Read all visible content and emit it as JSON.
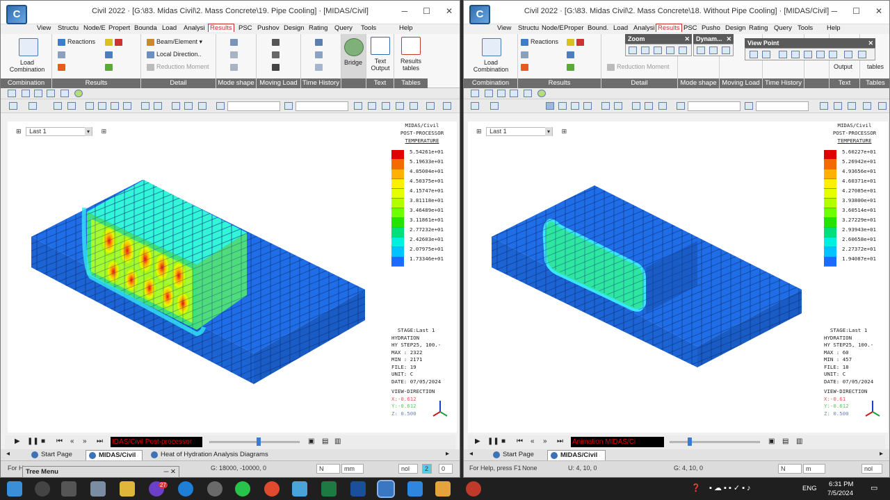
{
  "left": {
    "title": "Civil 2022 · [G:\\83. Midas Civil\\2. Mass Concrete\\19. Pipe Cooling] · [MIDAS/Civil]",
    "menu": [
      "View",
      "Structu",
      "Node/E",
      "Propert",
      "Bounda",
      "Load",
      "Analysi",
      "Results",
      "PSC",
      "Pushov",
      "Design",
      "Rating",
      "Query",
      "Tools",
      "Help"
    ],
    "ribbon": {
      "load_combination": "Load Combination",
      "reactions": "Reactions",
      "beam_element": "Beam/Element",
      "local_direction": "Local Direction..",
      "reduction_moment": "Reduction Moment",
      "bridge": "Bridge",
      "text_output": "Text Output",
      "results_tables": "Results tables",
      "groups": [
        "Combination",
        "Results",
        "Detail",
        "Mode shape",
        "Moving Load",
        "Time History",
        "",
        "Text",
        "Tables"
      ]
    },
    "stage": "Last 1",
    "legend": {
      "head": [
        "MIDAS/Civil",
        "POST-PROCESSOR",
        "TEMPERATURE"
      ],
      "values": [
        "5.54261e+01",
        "5.19633e+01",
        "4.85004e+01",
        "4.50375e+01",
        "4.15747e+01",
        "3.81118e+01",
        "3.46489e+01",
        "3.11861e+01",
        "2.77232e+01",
        "2.42603e+01",
        "2.07975e+01",
        "1.73346e+01"
      ],
      "colors": [
        "#e10000",
        "#f36b00",
        "#ffb000",
        "#fff000",
        "#e3ff00",
        "#b2ff00",
        "#6eff00",
        "#22e400",
        "#00e07a",
        "#00f0e0",
        "#00c4ff",
        "#1a6bff"
      ],
      "info": [
        "STAGE:Last 1",
        "HYDRATION",
        "HY STEP25, 100.-",
        "MAX : 2322",
        "MIN : 2171",
        "FILE: 19",
        "UNIT: C",
        "DATE: 07/05/2024"
      ],
      "view_dir": [
        "VIEW-DIRECTION",
        "X:-0.612",
        "Y:-0.612",
        "Z: 0.500"
      ]
    },
    "anim_label": "IDAS/Civil Post-processor",
    "tabs": [
      "Start Page",
      "MIDAS/Civil",
      "Heat of Hydration Analysis Diagrams"
    ],
    "status": {
      "help": "For H",
      "coords": "G: 18000, -10000, 0",
      "unit1": "N",
      "unit2": "mm",
      "nol": "nol",
      "num": "2",
      "zero": "0"
    },
    "tree_menu": "Tree Menu"
  },
  "right": {
    "title": "Civil 2022 · [G:\\83. Midas Civil\\2. Mass Concrete\\18. Without Pipe Cooling] · [MIDAS/Civil]",
    "menu": [
      "View",
      "Structu",
      "Node/E",
      "Proper",
      "Bound.",
      "Load",
      "Analysi",
      "Results",
      "PSC",
      "Pusho",
      "Design",
      "Rating",
      "Query",
      "Tools",
      "Help"
    ],
    "ribbon": {
      "load_combination": "Load Combination",
      "reactions": "Reactions",
      "reduction_moment": "Reduction Moment",
      "text_output": "Output",
      "results_tables": "tables",
      "groups": [
        "Combination",
        "Results",
        "Detail",
        "Mode shape",
        "Moving Load",
        "Time History",
        "Text",
        "Tables"
      ]
    },
    "panels": {
      "zoom": "Zoom",
      "dynamic": "Dynam...",
      "viewpoint": "View Point"
    },
    "stage": "Last 1",
    "legend": {
      "head": [
        "MIDAS/Civil",
        "POST-PROCESSOR",
        "TEMPERATURE"
      ],
      "values": [
        "5.60227e+01",
        "5.26942e+01",
        "4.93656e+01",
        "4.60371e+01",
        "4.27085e+01",
        "3.93800e+01",
        "3.60514e+01",
        "3.27229e+01",
        "2.93943e+01",
        "2.60658e+01",
        "2.27372e+01",
        "1.94087e+01"
      ],
      "colors": [
        "#e10000",
        "#f36b00",
        "#ffb000",
        "#fff000",
        "#e3ff00",
        "#b2ff00",
        "#6eff00",
        "#22e400",
        "#00e07a",
        "#00f0e0",
        "#00c4ff",
        "#1a6bff"
      ],
      "info": [
        "STAGE:Last 1",
        "HYDRATION",
        "HY STEP25, 100.-",
        "MAX : 60",
        "MIN : 457",
        "FILE: 18",
        "UNIT: C",
        "DATE: 07/05/2024"
      ],
      "view_dir": [
        "VIEW-DIRECTION",
        "X:-0.61",
        "Y:-0.612",
        "Z: 0.500"
      ]
    },
    "anim_label": "Animation     MIDAS/Ci",
    "tabs": [
      "Start Page",
      "MIDAS/Civil"
    ],
    "status": {
      "help": "For Help, press F1",
      "none": "None",
      "u_coords": "U: 4, 10, 0",
      "g_coords": "G: 4, 10, 0",
      "unit1": "N",
      "unit2": "m",
      "nol": "nol"
    }
  },
  "taskbar": {
    "time": "6:31 PM",
    "date": "7/5/2024",
    "lang": "ENG",
    "badge": "27"
  }
}
